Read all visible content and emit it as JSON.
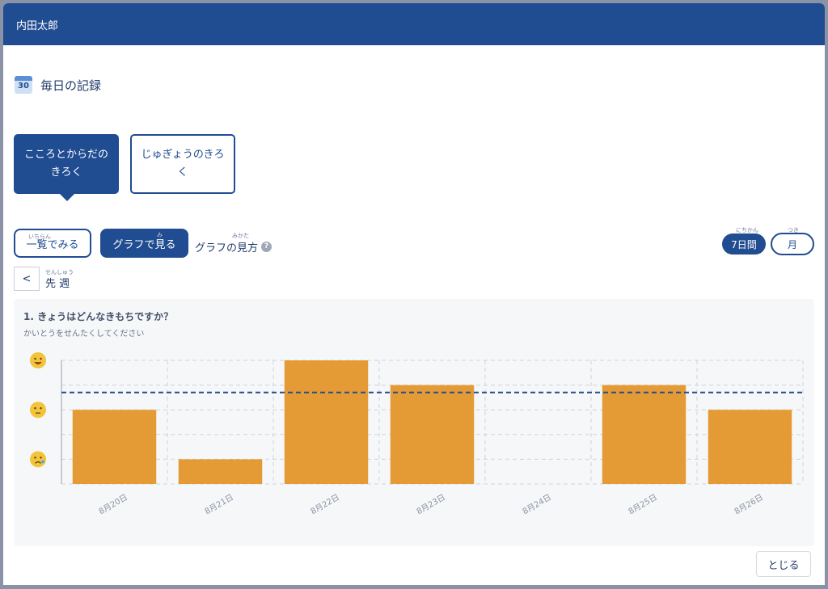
{
  "header": {
    "user_name": "内田太郎"
  },
  "page": {
    "title": "毎日の記録",
    "calendar_day": "30"
  },
  "tabs": [
    {
      "label_line1": "こころとからだの",
      "label_line2": "きろく"
    },
    {
      "label_line1": "じゅぎょうのきろ",
      "label_line2": "く"
    }
  ],
  "view": {
    "list_label": "一覧でみる",
    "list_ruby": "いちらん",
    "graph_label": "グラフで見る",
    "graph_ruby": "み",
    "howto_label": "グラフの見方",
    "howto_ruby": "みかた",
    "help_icon": "?"
  },
  "period": {
    "week_label": "7日間",
    "week_ruby": "にちかん",
    "month_label": "月",
    "month_ruby": "つき"
  },
  "nav": {
    "prev_symbol": "<",
    "week_text": "先 週",
    "week_ruby": "せんしゅう"
  },
  "chart_data": {
    "type": "bar",
    "title": "1. きょうはどんなきもちですか？",
    "subtitle": "かいとうをせんたくしてください",
    "categories": [
      "8月20日",
      "8月21日",
      "8月22日",
      "8月23日",
      "8月24日",
      "8月25日",
      "8月26日"
    ],
    "values": [
      3,
      1,
      5,
      4,
      null,
      4,
      3
    ],
    "ylim": [
      0,
      5
    ],
    "average_line": 3.7,
    "y_icons": [
      {
        "value": 5,
        "icon": "happy-face-icon"
      },
      {
        "value": 3,
        "icon": "neutral-face-icon"
      },
      {
        "value": 1,
        "icon": "sad-face-icon"
      }
    ],
    "bar_color": "#e59b35",
    "average_color": "#204c91",
    "grid": true
  },
  "footer": {
    "close_label": "とじる"
  }
}
